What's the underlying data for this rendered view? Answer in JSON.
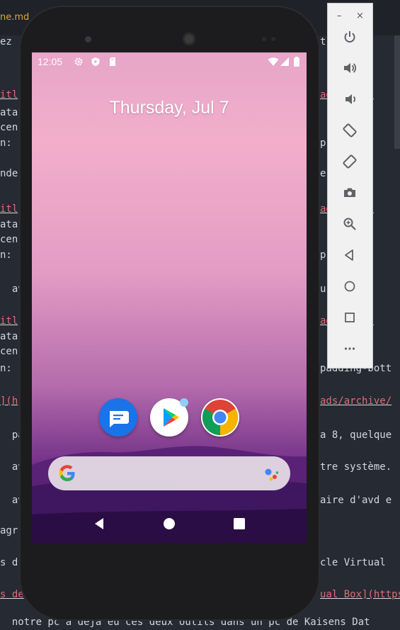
{
  "editor": {
    "tab_label": "ne.md",
    "lines": [
      {
        "left": "ez",
        "right": "t  orso"
      },
      {
        "left": "itl",
        "right": "ad](drive"
      },
      {
        "left": "ata",
        "right": ""
      },
      {
        "left": "cen",
        "right": ""
      },
      {
        "left": "n:",
        "right": "p  bott"
      },
      {
        "left": "nde",
        "right": "e  appem"
      },
      {
        "left": "itl",
        "right": "ad](drive"
      },
      {
        "left": "ata",
        "right": ""
      },
      {
        "left": "cen",
        "right": ""
      },
      {
        "left": "n:",
        "right": "p  bott"
      },
      {
        "left": "  av",
        "right": "u    et"
      },
      {
        "left": "itl",
        "right": "ad](drive"
      },
      {
        "left": "ata",
        "right": ""
      },
      {
        "left": "cen",
        "right": ""
      },
      {
        "left": "n:",
        "right": "padding-bott"
      },
      {
        "left": "](h",
        "right": "ads/archive/"
      },
      {
        "left": "  pa",
        "right": "a 8, quelque"
      },
      {
        "left": "  av",
        "right": "tre système."
      },
      {
        "left": "  av",
        "right": "aire d'avd e"
      },
      {
        "left": "agr",
        "right": ""
      },
      {
        "left": "s d",
        "right": "cle Virtual"
      },
      {
        "left": "s de",
        "right": "ual Box](https"
      },
      {
        "left": "  notre pc a déjà eu ces deux outils dans un pc de Kaisens Dat",
        "right": ""
      }
    ]
  },
  "phone": {
    "status_time": "12:05",
    "date_text": "Thursday, Jul 7",
    "dock_apps": [
      {
        "name": "Messages",
        "color": "#1a73e8"
      },
      {
        "name": "Play Store",
        "color": "#ffffff"
      },
      {
        "name": "Chrome",
        "color": "#ffffff"
      }
    ],
    "search_placeholder": ""
  },
  "emulator_toolbar": {
    "minimize": "–",
    "close": "×",
    "buttons": [
      "power-icon",
      "volume-up-icon",
      "volume-down-icon",
      "rotate-left-icon",
      "rotate-right-icon",
      "camera-icon",
      "zoom-icon",
      "back-icon",
      "home-icon",
      "overview-icon",
      "more-icon"
    ]
  }
}
